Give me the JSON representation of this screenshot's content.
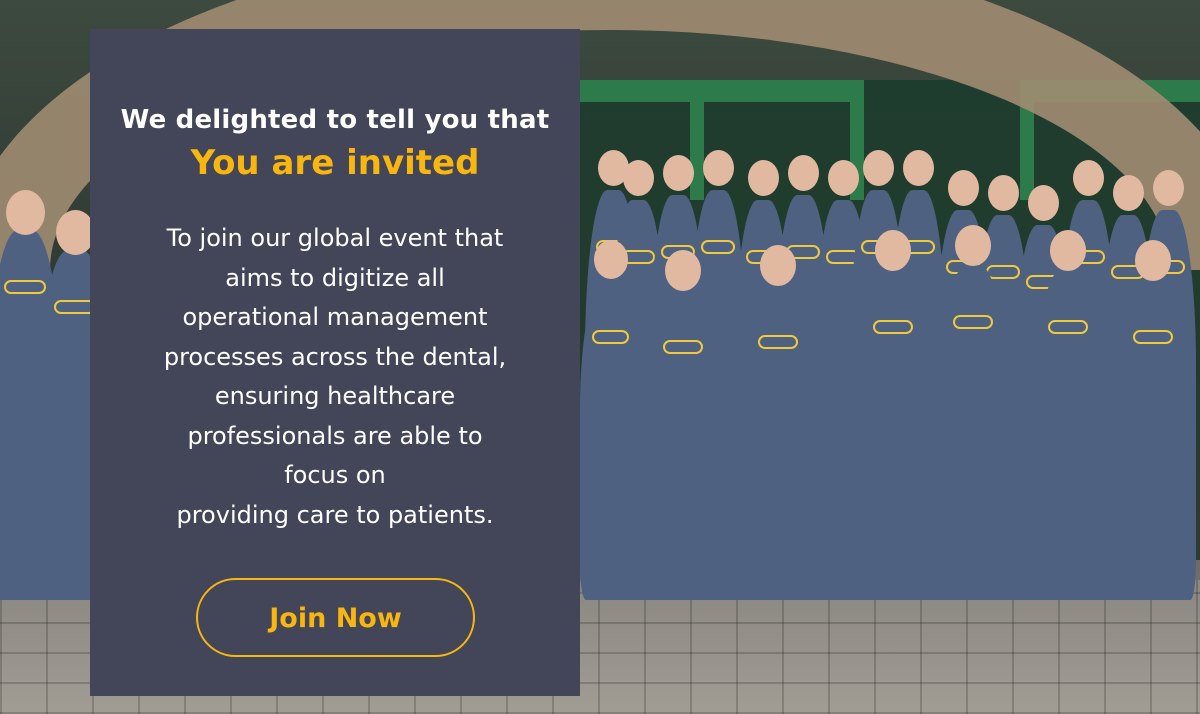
{
  "invite_card": {
    "intro_text": "We delighted to tell you that",
    "title": "You are invited",
    "body_lines": [
      "To join our global event that",
      "aims to digitize all",
      "operational management",
      "processes across the dental,",
      "ensuring healthcare",
      "professionals are able to",
      "focus on",
      "providing care to patients."
    ],
    "cta_label": "Join Now"
  },
  "colors": {
    "card_background": "#434558",
    "accent": "#f8b60f",
    "text": "#ffffff",
    "shirt": "#4f6181",
    "door_frame": "#2d7a4b"
  }
}
